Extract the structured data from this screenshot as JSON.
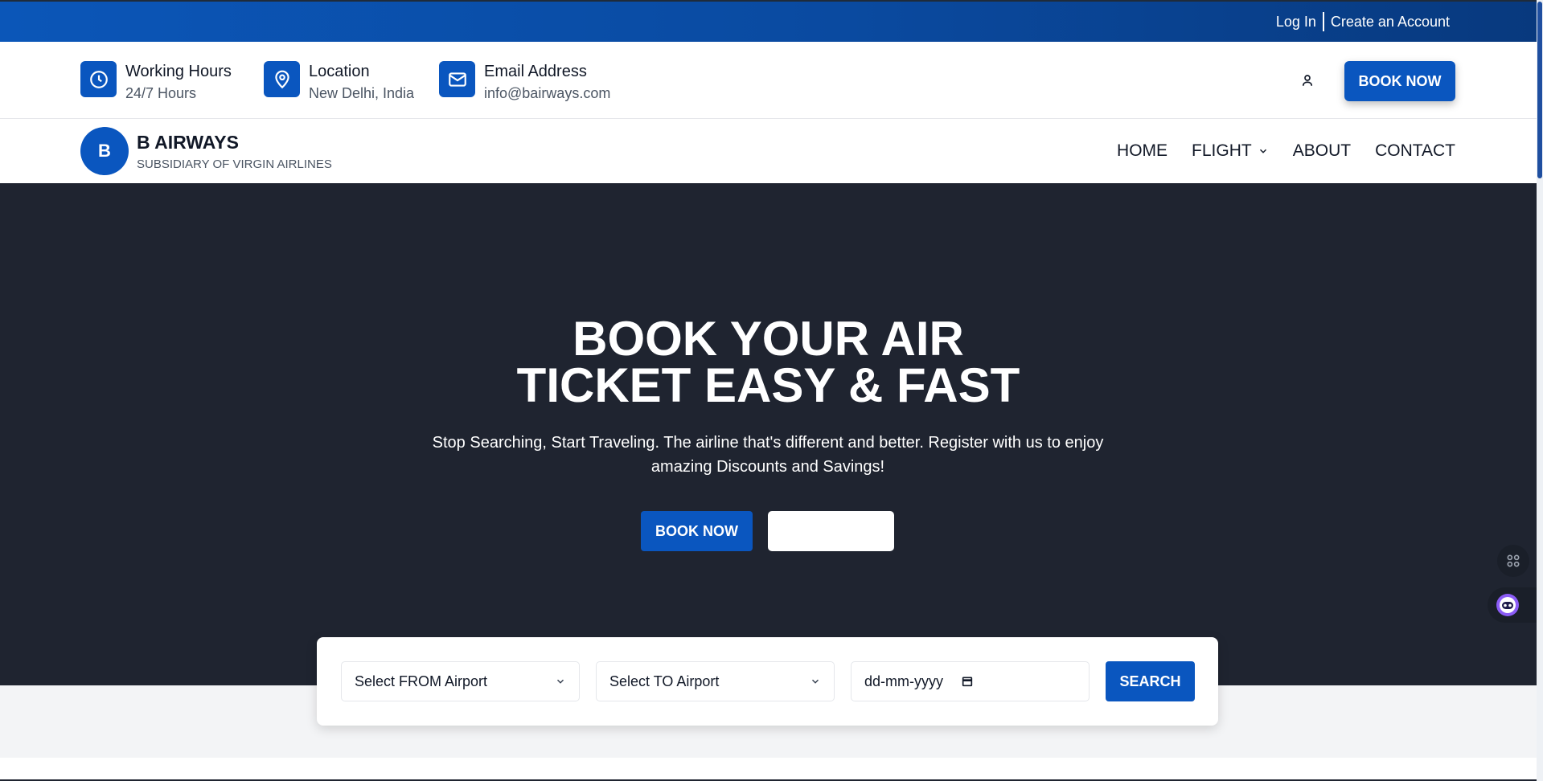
{
  "topbar": {
    "login": "Log In",
    "create_account": "Create an Account"
  },
  "info": {
    "hours": {
      "title": "Working Hours",
      "value": "24/7 Hours",
      "icon": "clock-icon"
    },
    "location": {
      "title": "Location",
      "value": "New Delhi, India",
      "icon": "map-pin-icon"
    },
    "email": {
      "title": "Email Address",
      "value": "info@bairways.com",
      "icon": "mail-icon"
    },
    "book_now": "BOOK NOW"
  },
  "brand": {
    "initial": "B",
    "name": "B AIRWAYS",
    "subtitle": "SUBSIDIARY OF VIRGIN AIRLINES"
  },
  "nav": {
    "items": [
      "HOME",
      "FLIGHT",
      "ABOUT",
      "CONTACT"
    ]
  },
  "hero": {
    "title_line1": "BOOK YOUR AIR",
    "title_line2": "TICKET EASY & FAST",
    "subtitle": "Stop Searching, Start Traveling. The airline that's different and better. Register with us to enjoy amazing Discounts and Savings!",
    "book_now": "BOOK NOW",
    "secondary_label": ""
  },
  "search": {
    "from_placeholder": "Select FROM Airport",
    "to_placeholder": "Select TO Airport",
    "date_placeholder": "dd-mm-yyyy",
    "button": "SEARCH"
  },
  "colors": {
    "primary": "#0a56bf",
    "hero_bg": "#1f2430",
    "topbar": "#0a4aa0"
  }
}
